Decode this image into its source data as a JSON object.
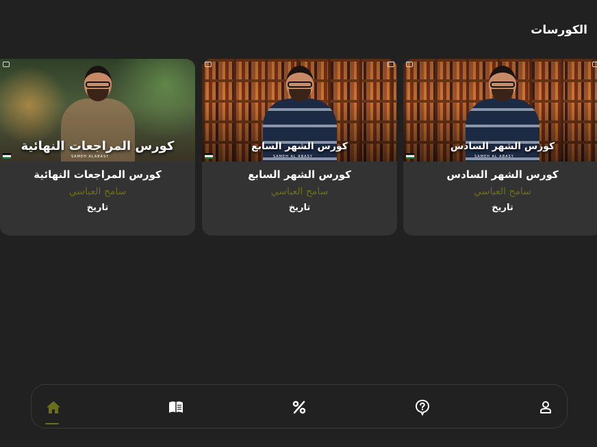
{
  "page": {
    "title": "الكورسات"
  },
  "courses": [
    {
      "title": "كورس الشهر السادس",
      "author": "سامح العباسي",
      "category": "تاريخ",
      "thumbnail_text": "كورس الشهر السادس",
      "thumbnail_tag": "SAMEH AL ABASY"
    },
    {
      "title": "كورس الشهر السابع",
      "author": "سامح العباسي",
      "category": "تاريخ",
      "thumbnail_text": "كورس الشهر السابع",
      "thumbnail_tag": "SAMEH AL ABASY"
    },
    {
      "title": "كورس المراجعات النهائية",
      "author": "سامح العباسي",
      "category": "تاريخ",
      "thumbnail_text": "كورس المراجعات النهائية",
      "thumbnail_tag": "SAMEH ALABASY"
    }
  ],
  "nav": {
    "items": [
      {
        "icon": "home-icon",
        "active": true
      },
      {
        "icon": "book-icon",
        "active": false
      },
      {
        "icon": "percent-icon",
        "active": false
      },
      {
        "icon": "help-icon",
        "active": false
      },
      {
        "icon": "profile-icon",
        "active": false
      }
    ]
  },
  "colors": {
    "background": "#212121",
    "card": "#333333",
    "accent": "#6b6f1a",
    "text": "#ffffff"
  }
}
